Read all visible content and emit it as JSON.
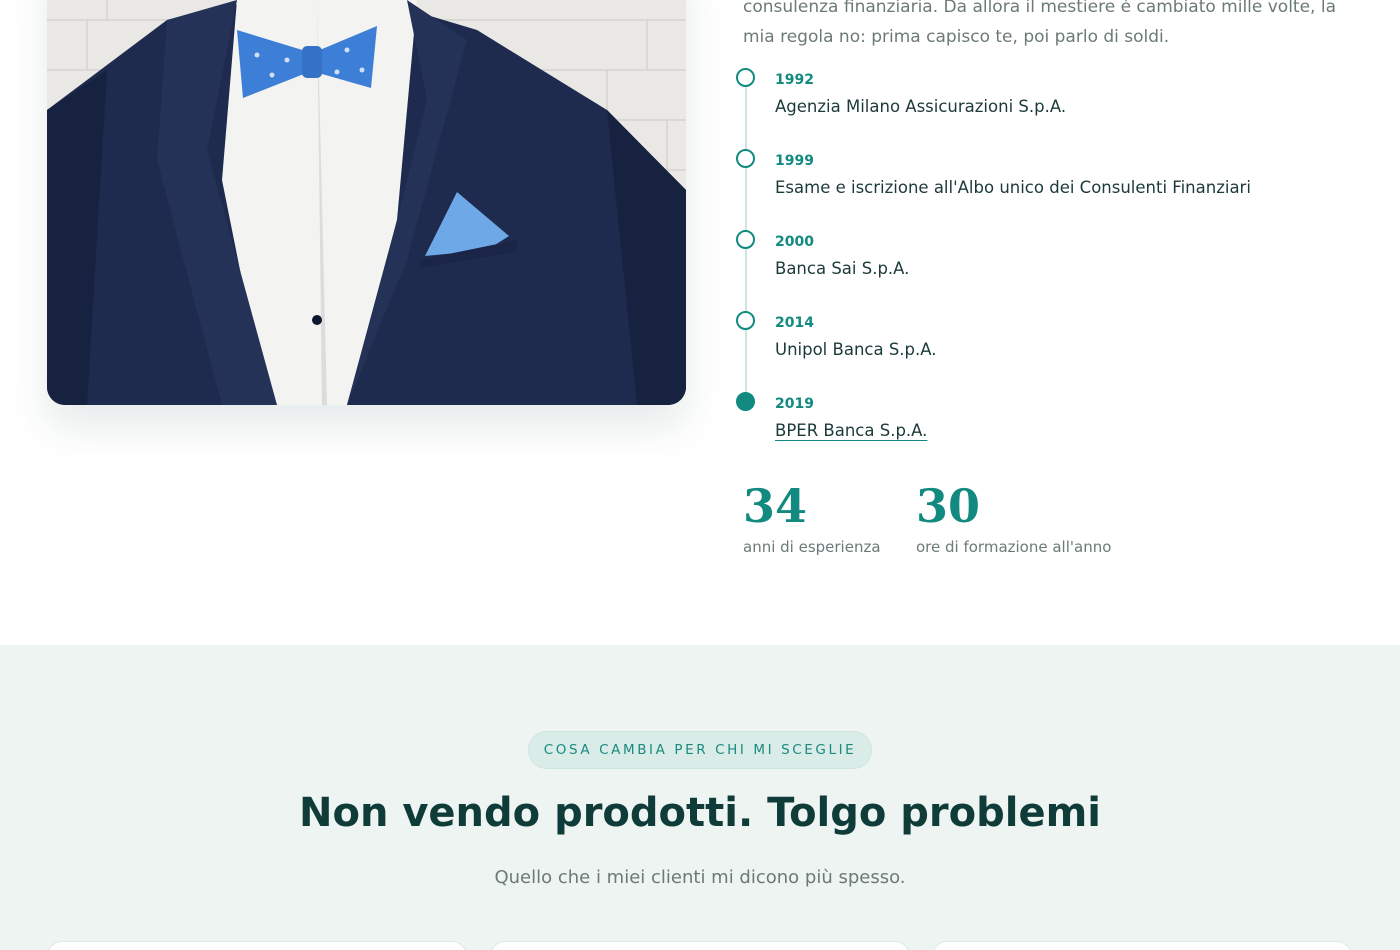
{
  "about": {
    "intro_lines": [
      "consulenza finanziaria. Da allora il mestiere è cambiato mille volte, la",
      "mia regola no: prima capisco te, poi parlo di soldi."
    ],
    "timeline": [
      {
        "year": "1992",
        "org": "Agenzia Milano Assicurazioni S.p.A.",
        "current": false
      },
      {
        "year": "1999",
        "org": "Esame e iscrizione all'Albo unico dei Consulenti Finanziari",
        "current": false
      },
      {
        "year": "2000",
        "org": "Banca Sai S.p.A.",
        "current": false
      },
      {
        "year": "2014",
        "org": "Unipol Banca S.p.A.",
        "current": false
      },
      {
        "year": "2019",
        "org": "BPER Banca S.p.A.",
        "current": true
      }
    ],
    "stats": [
      {
        "value": "34",
        "label": "anni di esperienza"
      },
      {
        "value": "30",
        "label": "ore di formazione all'anno"
      }
    ]
  },
  "benefits": {
    "eyebrow": "COSA CAMBIA PER CHI MI SCEGLIE",
    "title": "Non vendo prodotti. Tolgo problemi",
    "subtitle": "Quello che i miei clienti mi dicono più spesso."
  },
  "colors": {
    "accent": "#128a80",
    "heading": "#0f3c38",
    "muted": "#6b7a78",
    "section_bg": "#eef4f2"
  }
}
